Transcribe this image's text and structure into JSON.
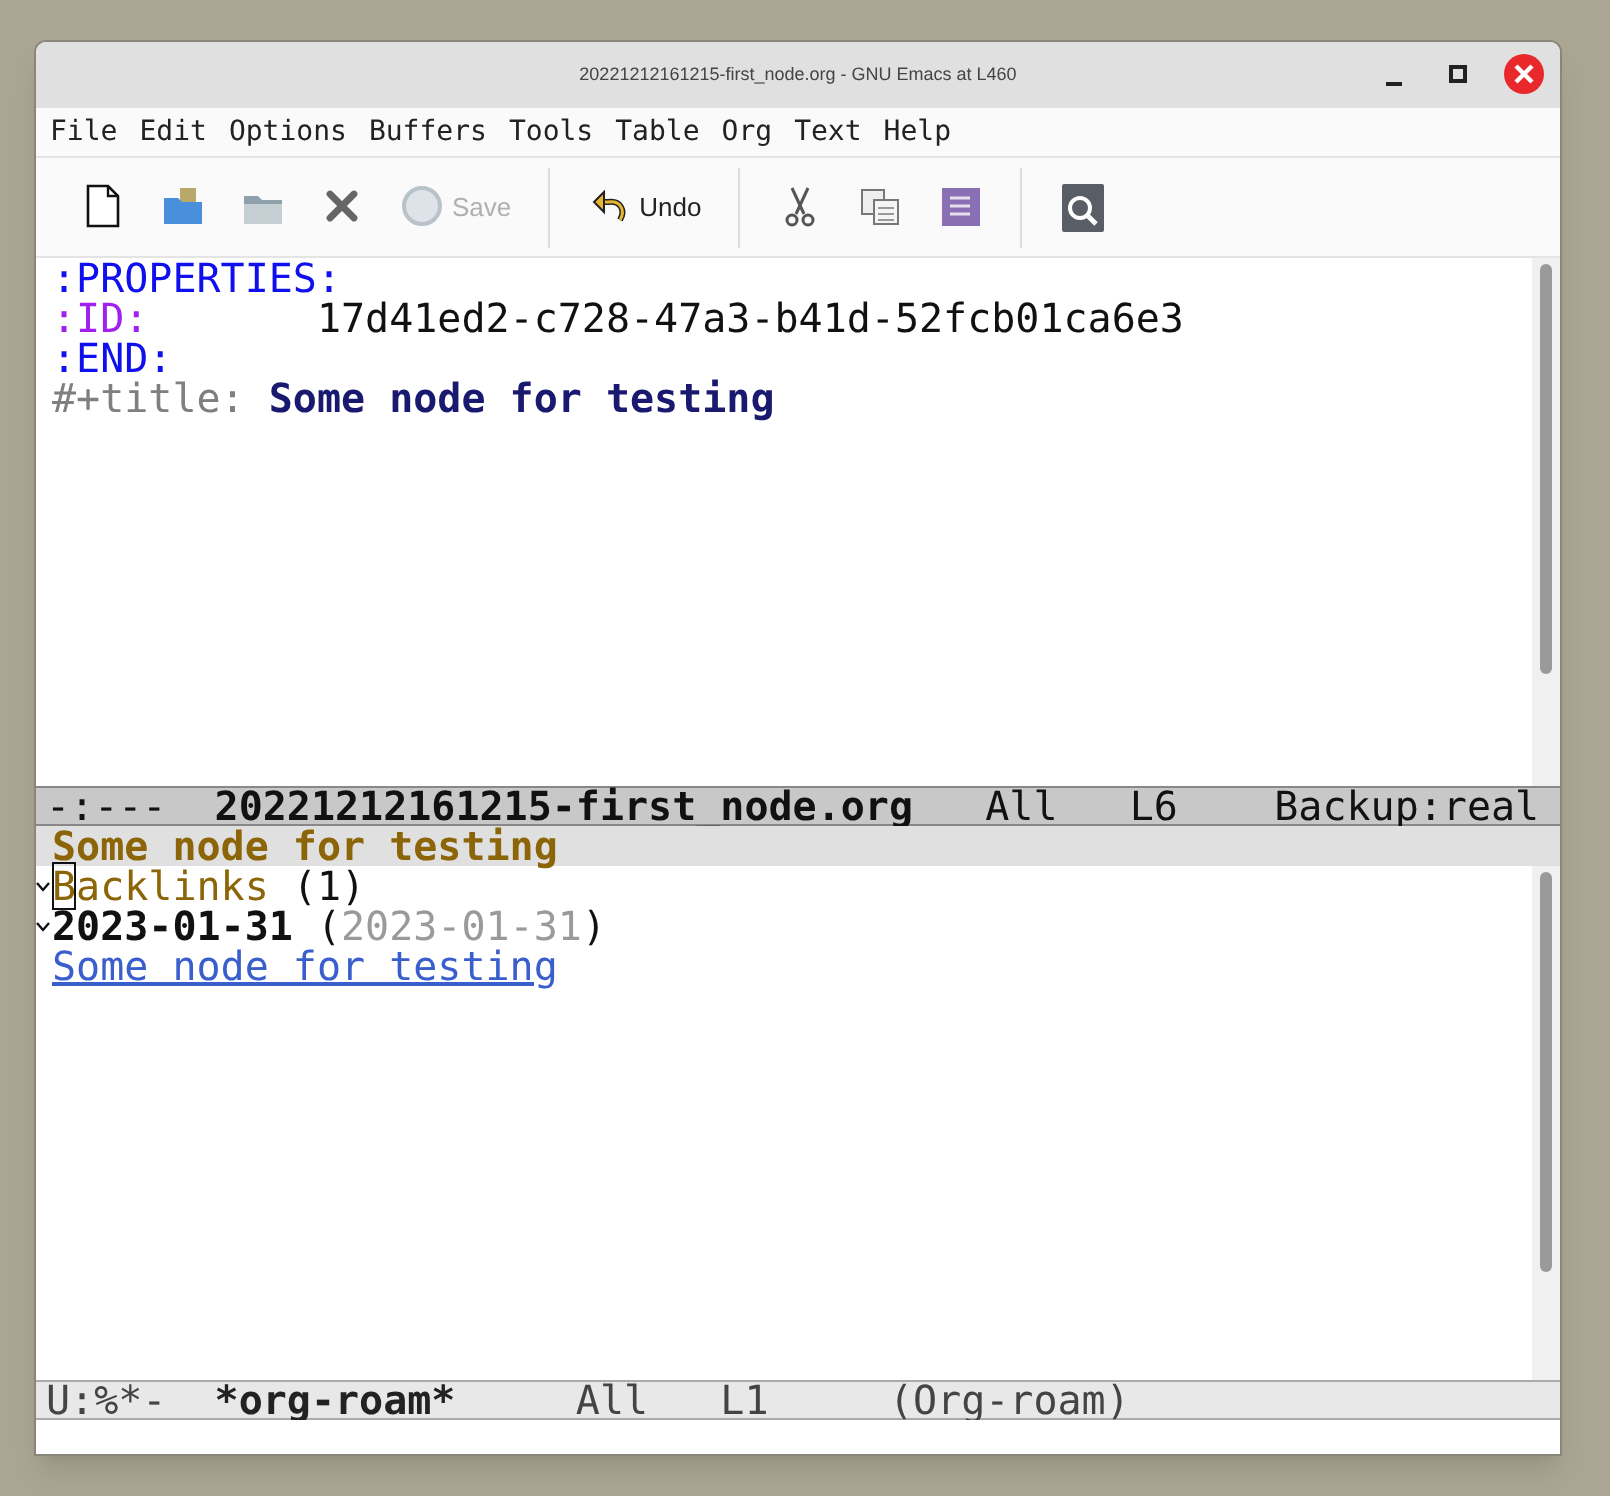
{
  "window": {
    "title": "20221212161215-first_node.org - GNU Emacs at L460"
  },
  "menu": [
    "File",
    "Edit",
    "Options",
    "Buffers",
    "Tools",
    "Table",
    "Org",
    "Text",
    "Help"
  ],
  "toolbar": [
    {
      "kind": "new"
    },
    {
      "kind": "dired"
    },
    {
      "kind": "open"
    },
    {
      "kind": "close"
    },
    {
      "kind": "save",
      "label": "Save",
      "disabled": true
    },
    {
      "kind": "sep"
    },
    {
      "kind": "undo",
      "label": "Undo",
      "disabled": false
    },
    {
      "kind": "sep"
    },
    {
      "kind": "cut"
    },
    {
      "kind": "copy"
    },
    {
      "kind": "paste"
    },
    {
      "kind": "sep"
    },
    {
      "kind": "search"
    }
  ],
  "top_buffer": {
    "lines": [
      {
        "segments": [
          {
            "text": ":PROPERTIES:",
            "kind": "keyword"
          }
        ]
      },
      {
        "segments": [
          {
            "text": ":ID:",
            "kind": "property"
          },
          {
            "text": "       17d41ed2-c728-47a3-b41d-52fcb01ca6e3",
            "kind": "plain"
          }
        ]
      },
      {
        "segments": [
          {
            "text": ":END:",
            "kind": "keyword"
          }
        ]
      },
      {
        "segments": [
          {
            "text": "#+title: ",
            "kind": "meta"
          },
          {
            "text": "Some node for testing",
            "kind": "title"
          }
        ]
      }
    ],
    "mode_line": [
      {
        "text": "-:---  ",
        "kind": "plain"
      },
      {
        "text": "20221212161215-first_node.org",
        "kind": "bold"
      },
      {
        "text": "   All   L6    Backup:real",
        "kind": "plain"
      }
    ],
    "active": true
  },
  "bottom_buffer": {
    "header": "Some node for testing",
    "lines": [
      {
        "expanded": true,
        "segments": [
          {
            "text": "B",
            "kind": "section",
            "cursor": true
          },
          {
            "text": "acklinks",
            "kind": "section"
          },
          {
            "text": " (1)",
            "kind": "plain"
          }
        ]
      },
      {
        "expanded": true,
        "segments": [
          {
            "text": "2023-01-31",
            "kind": "bold"
          },
          {
            "text": " (",
            "kind": "plain"
          },
          {
            "text": "2023-01-31",
            "kind": "dim"
          },
          {
            "text": ")",
            "kind": "plain"
          }
        ]
      },
      {
        "expanded": false,
        "segments": [
          {
            "text": "Some node for testing",
            "kind": "link"
          }
        ]
      }
    ],
    "mode_line": [
      {
        "text": "U:%*-  ",
        "kind": "plain"
      },
      {
        "text": "*org-roam*",
        "kind": "bold"
      },
      {
        "text": "     All   L1     (Org-roam)",
        "kind": "plain"
      }
    ],
    "active": false
  }
}
